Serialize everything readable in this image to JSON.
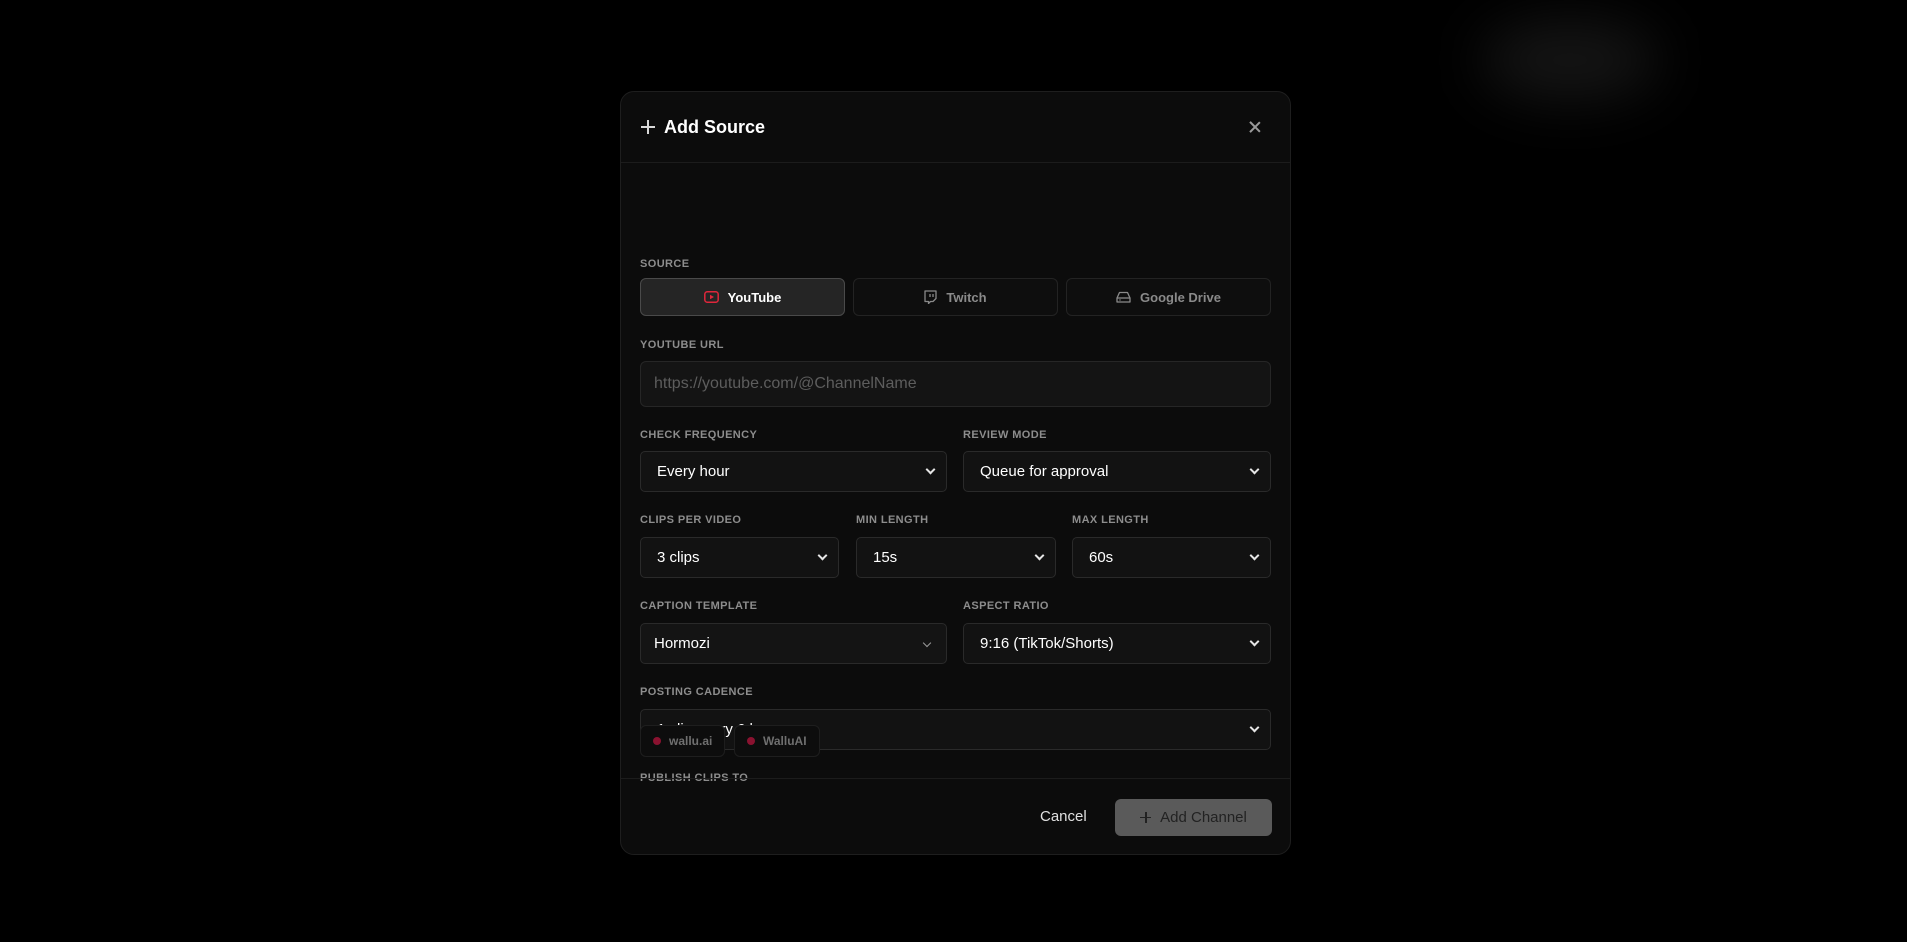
{
  "modal": {
    "title": "Add Source"
  },
  "source": {
    "label": "SOURCE",
    "tabs": [
      {
        "label": "YouTube",
        "icon": "youtube-icon",
        "active": true,
        "icon_color": "#e0263b"
      },
      {
        "label": "Twitch",
        "icon": "twitch-icon",
        "active": false
      },
      {
        "label": "Google Drive",
        "icon": "drive-icon",
        "active": false
      }
    ]
  },
  "url": {
    "label": "YOUTUBE URL",
    "value": "",
    "placeholder": "https://youtube.com/@ChannelName"
  },
  "check_frequency": {
    "label": "CHECK FREQUENCY",
    "value": "Every hour"
  },
  "review_mode": {
    "label": "REVIEW MODE",
    "value": "Queue for approval"
  },
  "clips_per_video": {
    "label": "CLIPS PER VIDEO",
    "value": "3 clips"
  },
  "min_length": {
    "label": "MIN LENGTH",
    "value": "15s"
  },
  "max_length": {
    "label": "MAX LENGTH",
    "value": "60s"
  },
  "caption_template": {
    "label": "CAPTION TEMPLATE",
    "value": "Hormozi"
  },
  "aspect_ratio": {
    "label": "ASPECT RATIO",
    "value": "9:16 (TikTok/Shorts)"
  },
  "posting_cadence": {
    "label": "POSTING CADENCE",
    "value": "1 clip every 6 hours"
  },
  "publish": {
    "label": "PUBLISH CLIPS TO",
    "accounts": [
      {
        "label": "wallu.ai"
      },
      {
        "label": "WalluAI"
      }
    ],
    "dot_color": "#8a1230"
  },
  "footer": {
    "cancel_label": "Cancel",
    "add_label": "Add Channel"
  }
}
